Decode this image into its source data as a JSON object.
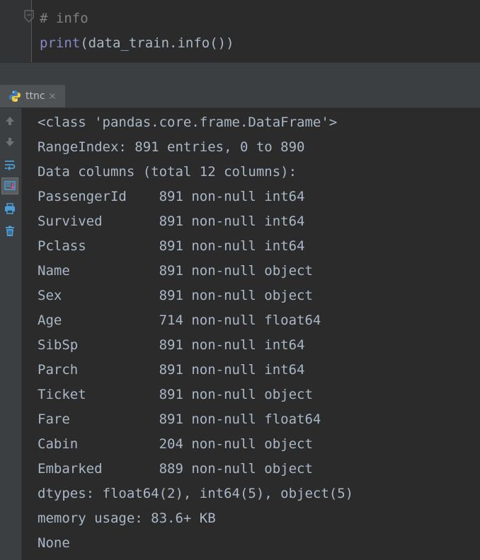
{
  "editor": {
    "line1": "# info",
    "line2_keyword": "print",
    "line2_rest": "(data_train.info())"
  },
  "run_tab": {
    "label": "ttnc",
    "close": "×"
  },
  "console": {
    "lines": [
      "<class 'pandas.core.frame.DataFrame'>",
      "RangeIndex: 891 entries, 0 to 890",
      "Data columns (total 12 columns):",
      "PassengerId    891 non-null int64",
      "Survived       891 non-null int64",
      "Pclass         891 non-null int64",
      "Name           891 non-null object",
      "Sex            891 non-null object",
      "Age            714 non-null float64",
      "SibSp          891 non-null int64",
      "Parch          891 non-null int64",
      "Ticket         891 non-null object",
      "Fare           891 non-null float64",
      "Cabin          204 non-null object",
      "Embarked       889 non-null object",
      "dtypes: float64(2), int64(5), object(5)",
      "memory usage: 83.6+ KB",
      "None"
    ]
  },
  "toolbar": {
    "icons": [
      "up-arrow-icon",
      "down-arrow-icon",
      "soft-wrap-icon",
      "scroll-to-end-icon",
      "print-icon",
      "trash-icon"
    ]
  },
  "colors": {
    "background": "#2b2b2b",
    "text": "#a9b7c6",
    "comment": "#808080",
    "builtin": "#8888c6",
    "panel": "#3c3f41"
  }
}
